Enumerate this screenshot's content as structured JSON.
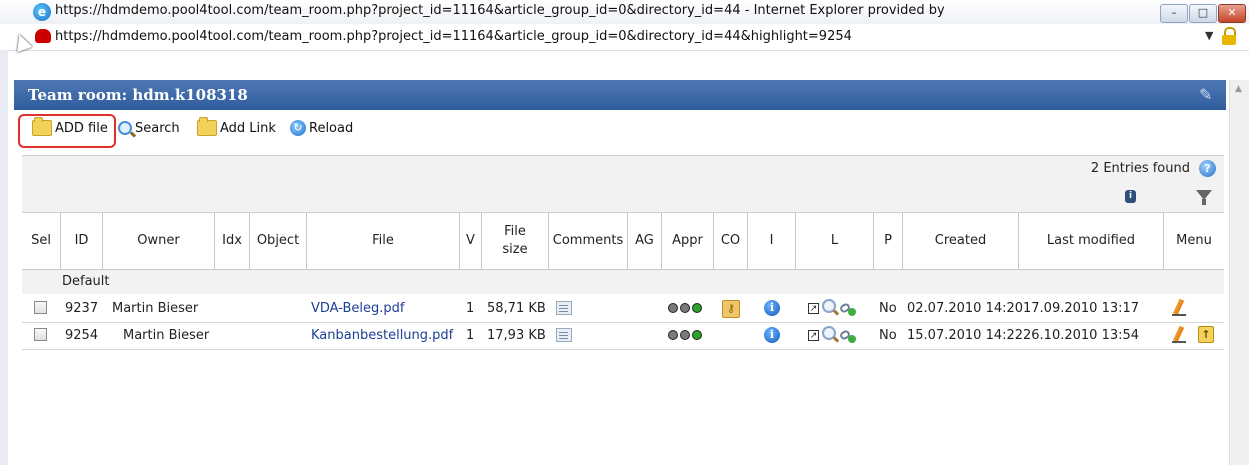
{
  "window": {
    "title": "https://hdmdemo.pool4tool.com/team_room.php?project_id=11164&article_group_id=0&directory_id=44 - Internet Explorer provided by",
    "address": "https://hdmdemo.pool4tool.com/team_room.php?project_id=11164&article_group_id=0&directory_id=44&highlight=9254",
    "buttons": {
      "minimize": "–",
      "maximize": "□",
      "close": "✕"
    }
  },
  "header": {
    "title": "Team room: hdm.k108318"
  },
  "toolbar": {
    "add_file": "ADD file",
    "search": "Search",
    "add_link": "Add Link",
    "reload": "Reload"
  },
  "info": {
    "entries_found": "2 Entries found"
  },
  "columns": {
    "sel": "Sel",
    "id": "ID",
    "owner": "Owner",
    "idx": "Idx",
    "object": "Object",
    "file": "File",
    "v": "V",
    "file_size": "File size",
    "comments": "Comments",
    "ag": "AG",
    "appr": "Appr",
    "co": "CO",
    "i": "I",
    "l": "L",
    "p": "P",
    "created": "Created",
    "last_modified": "Last modified",
    "menu": "Menu"
  },
  "group": {
    "label": "Default"
  },
  "rows": [
    {
      "id": "9237",
      "owner": "Martin Bieser",
      "file": "VDA-Beleg.pdf",
      "v": "1",
      "size": "58,71 KB",
      "p": "No",
      "created": "02.07.2010 14:20",
      "modified": "17.09.2010 13:17",
      "lights": [
        "#7a7a7a",
        "#7a7a7a",
        "#2aa52a"
      ]
    },
    {
      "id": "9254",
      "owner": "Martin Bieser",
      "file": "Kanbanbestellung.pdf",
      "v": "1",
      "size": "17,93 KB",
      "p": "No",
      "created": "15.07.2010 14:22",
      "modified": "26.10.2010 13:54",
      "lights": [
        "#7a7a7a",
        "#7a7a7a",
        "#2aa52a"
      ]
    }
  ],
  "colors": {
    "header_blue": "#2f5c9c",
    "link": "#1b3f95",
    "highlight_red": "#e0302b"
  }
}
